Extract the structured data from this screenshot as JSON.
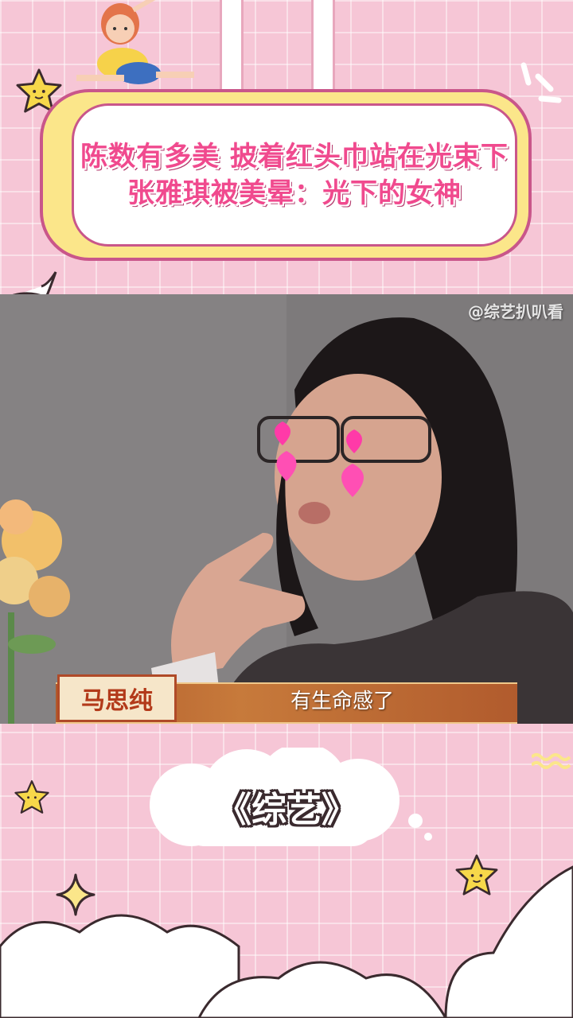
{
  "header": {
    "title_line1": "陈数有多美 披着红头巾站在光束下",
    "title_line2": "张雅琪被美晕：光下的女神"
  },
  "video": {
    "watermark": "@综艺扒叭看",
    "name_tag": "马思纯",
    "subtitle": "有生命感了"
  },
  "footer": {
    "label": "《综艺》"
  },
  "colors": {
    "background": "#f6c6d6",
    "banner_fill": "#fbe68a",
    "banner_border": "#c9568a",
    "title_text": "#f04a8e"
  }
}
